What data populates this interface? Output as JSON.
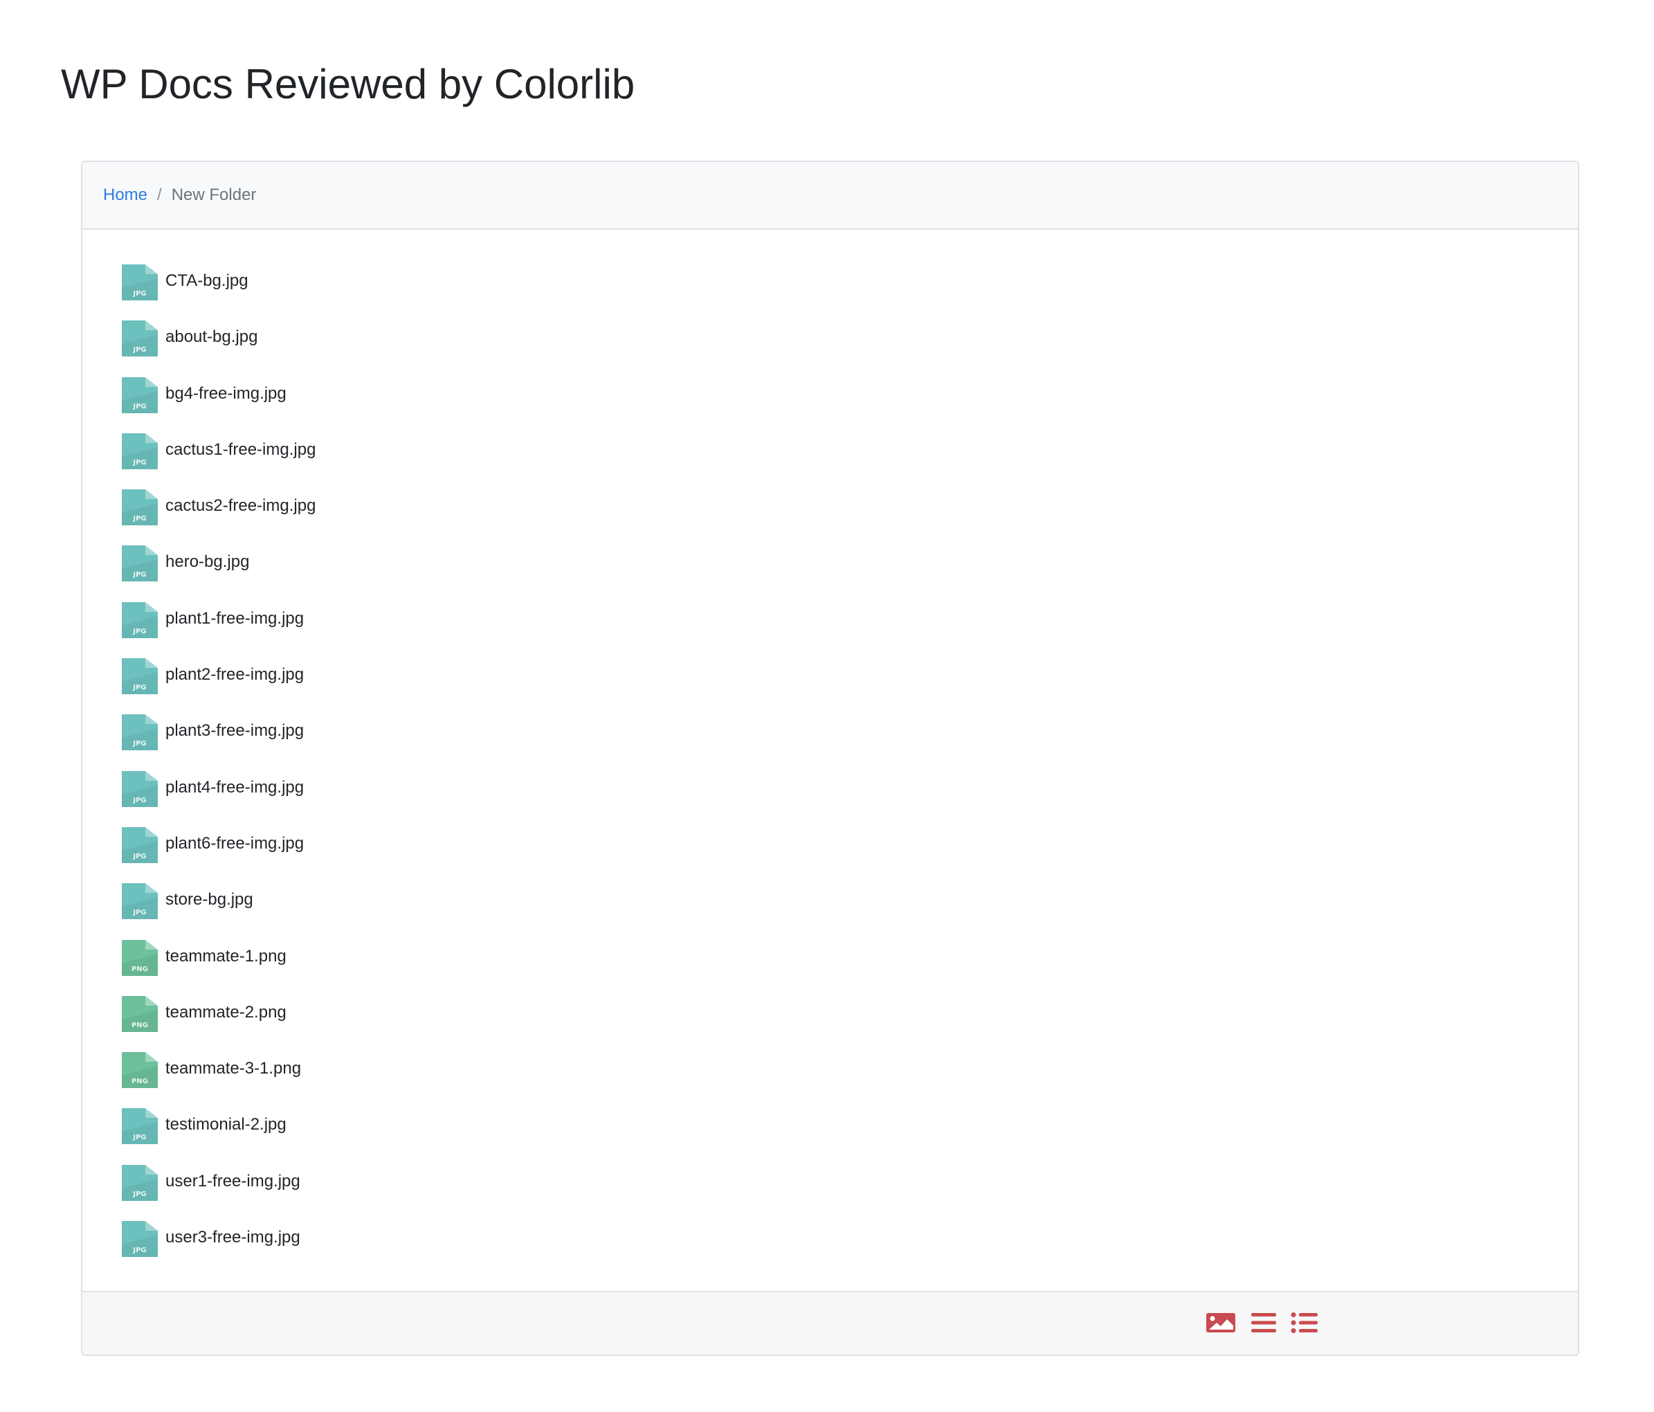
{
  "page": {
    "title": "WP Docs Reviewed by Colorlib"
  },
  "breadcrumb": {
    "home_label": "Home",
    "separator": "/",
    "current_label": "New Folder"
  },
  "colors": {
    "jpg_icon": "#6cc0bd",
    "png_icon": "#6cc09a",
    "link": "#2f7be3",
    "footer_icons": "#c94a50"
  },
  "files": [
    {
      "name": "CTA-bg.jpg",
      "type": "JPG",
      "icon": "jpg-file-icon"
    },
    {
      "name": "about-bg.jpg",
      "type": "JPG",
      "icon": "jpg-file-icon"
    },
    {
      "name": "bg4-free-img.jpg",
      "type": "JPG",
      "icon": "jpg-file-icon"
    },
    {
      "name": "cactus1-free-img.jpg",
      "type": "JPG",
      "icon": "jpg-file-icon"
    },
    {
      "name": "cactus2-free-img.jpg",
      "type": "JPG",
      "icon": "jpg-file-icon"
    },
    {
      "name": "hero-bg.jpg",
      "type": "JPG",
      "icon": "jpg-file-icon"
    },
    {
      "name": "plant1-free-img.jpg",
      "type": "JPG",
      "icon": "jpg-file-icon"
    },
    {
      "name": "plant2-free-img.jpg",
      "type": "JPG",
      "icon": "jpg-file-icon"
    },
    {
      "name": "plant3-free-img.jpg",
      "type": "JPG",
      "icon": "jpg-file-icon"
    },
    {
      "name": "plant4-free-img.jpg",
      "type": "JPG",
      "icon": "jpg-file-icon"
    },
    {
      "name": "plant6-free-img.jpg",
      "type": "JPG",
      "icon": "jpg-file-icon"
    },
    {
      "name": "store-bg.jpg",
      "type": "JPG",
      "icon": "jpg-file-icon"
    },
    {
      "name": "teammate-1.png",
      "type": "PNG",
      "icon": "png-file-icon"
    },
    {
      "name": "teammate-2.png",
      "type": "PNG",
      "icon": "png-file-icon"
    },
    {
      "name": "teammate-3-1.png",
      "type": "PNG",
      "icon": "png-file-icon"
    },
    {
      "name": "testimonial-2.jpg",
      "type": "JPG",
      "icon": "jpg-file-icon"
    },
    {
      "name": "user1-free-img.jpg",
      "type": "JPG",
      "icon": "jpg-file-icon"
    },
    {
      "name": "user3-free-img.jpg",
      "type": "JPG",
      "icon": "jpg-file-icon"
    }
  ],
  "footer": {
    "view_buttons": [
      {
        "icon": "image-view-icon"
      },
      {
        "icon": "list-view-icon"
      },
      {
        "icon": "detailed-list-view-icon"
      }
    ]
  }
}
